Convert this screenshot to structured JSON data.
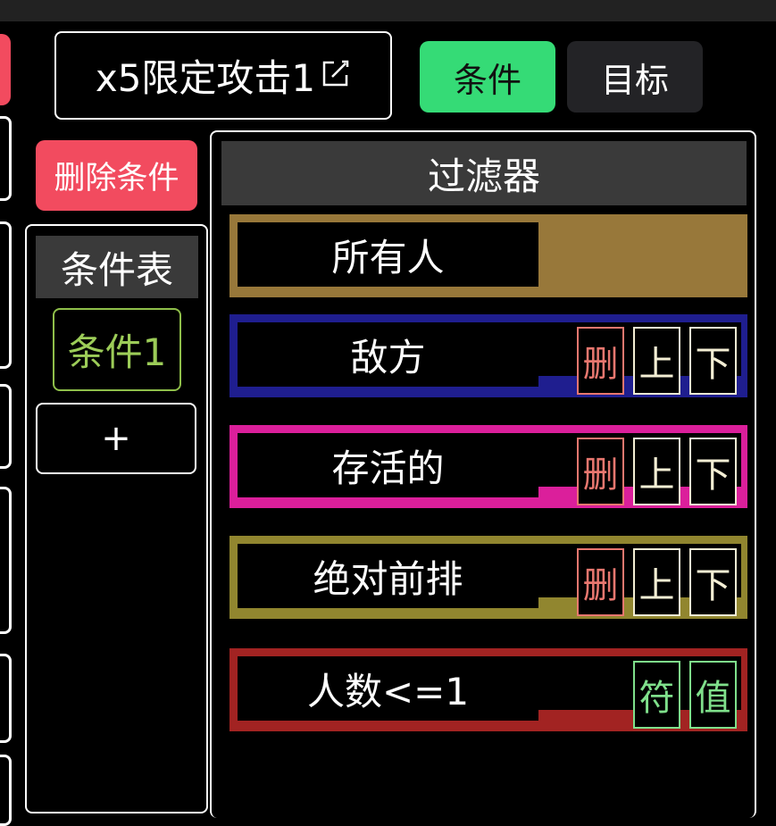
{
  "header": {
    "title": "x5限定攻击1",
    "title_icon": "edit-icon"
  },
  "tabs": [
    {
      "label": "条件",
      "active": true,
      "color": "#35db76"
    },
    {
      "label": "目标",
      "active": false,
      "color": "#232326"
    }
  ],
  "delete_condition_label": "删除条件",
  "condition_table": {
    "title": "条件表",
    "items": [
      "条件1"
    ],
    "add_label": "+"
  },
  "filter": {
    "title": "过滤器",
    "rows": [
      {
        "label": "所有人",
        "color": "#98783a",
        "buttons": []
      },
      {
        "label": "敌方",
        "color": "#1f1e8f",
        "buttons": [
          "删",
          "上",
          "下"
        ]
      },
      {
        "label": "存活的",
        "color": "#db1f9b",
        "buttons": [
          "删",
          "上",
          "下"
        ]
      },
      {
        "label": "绝对前排",
        "color": "#91862f",
        "buttons": [
          "删",
          "上",
          "下"
        ]
      },
      {
        "label": "人数<=1",
        "color": "#a22322",
        "buttons": [
          "符",
          "值"
        ]
      }
    ]
  }
}
